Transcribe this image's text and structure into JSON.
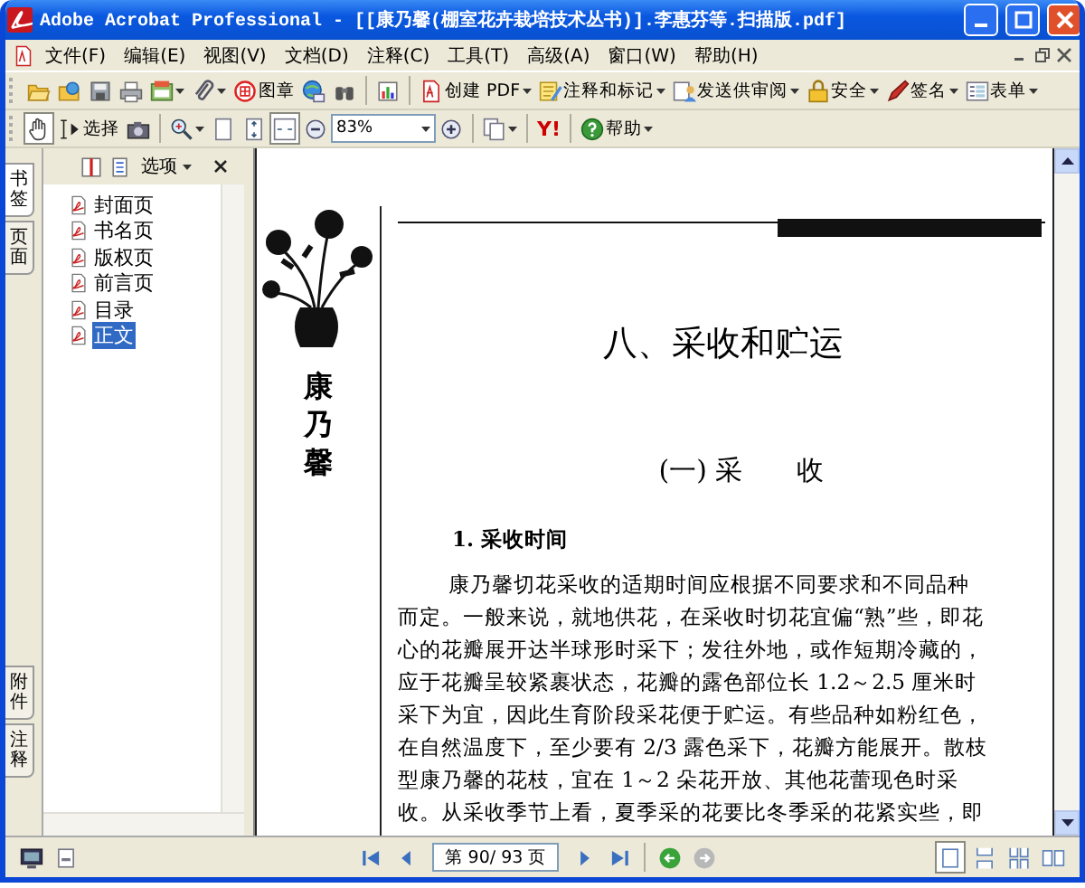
{
  "window": {
    "title": "Adobe Acrobat Professional - [[康乃馨(棚室花卉栽培技术丛书)].李惠芬等.扫描版.pdf]"
  },
  "menu": [
    "文件(F)",
    "编辑(E)",
    "视图(V)",
    "文档(D)",
    "注释(C)",
    "工具(T)",
    "高级(A)",
    "窗口(W)",
    "帮助(H)"
  ],
  "toolbar": [
    {
      "kind": "open"
    },
    {
      "kind": "openweb"
    },
    {
      "kind": "save"
    },
    {
      "kind": "print"
    },
    {
      "kind": "organizer",
      "dropdown": true
    },
    {
      "kind": "attach",
      "dropdown": true
    },
    {
      "kind": "stamp",
      "label": "图章"
    },
    {
      "kind": "email"
    },
    {
      "kind": "find"
    },
    {
      "kind": "separator"
    },
    {
      "kind": "chart"
    },
    {
      "kind": "separator"
    },
    {
      "kind": "createpdf",
      "label": "创建 PDF",
      "dropdown": true
    },
    {
      "kind": "comment",
      "label": "注释和标记",
      "dropdown": true
    },
    {
      "kind": "review",
      "label": "发送供审阅",
      "dropdown": true
    },
    {
      "kind": "lock",
      "label": "安全",
      "dropdown": true
    },
    {
      "kind": "sign",
      "label": "签名",
      "dropdown": true
    },
    {
      "kind": "form",
      "label": "表单",
      "dropdown": true
    }
  ],
  "toolbar2": [
    {
      "kind": "hand",
      "selected": true
    },
    {
      "kind": "select",
      "label": "选择",
      "selected": false
    },
    {
      "kind": "snapshot",
      "selected": false
    },
    {
      "kind": "separator"
    },
    {
      "kind": "zoom",
      "dropdown": true,
      "selected": false
    },
    {
      "kind": "page",
      "selected": false
    },
    {
      "kind": "fitheight",
      "selected": false
    },
    {
      "kind": "fitwidth",
      "selected": true
    },
    {
      "kind": "zoomout",
      "selected": false
    },
    {
      "kind": "zoomfield",
      "value": "83%"
    },
    {
      "kind": "zoomin",
      "selected": false
    },
    {
      "kind": "separator"
    },
    {
      "kind": "pages",
      "dropdown": true,
      "selected": false
    },
    {
      "kind": "separator"
    },
    {
      "kind": "yahoo",
      "label": "Y!",
      "selected": false
    },
    {
      "kind": "separator"
    },
    {
      "kind": "help",
      "label": "帮助",
      "dropdown": true,
      "selected": false
    }
  ],
  "side_tabs_top": [
    {
      "label": "书签",
      "selected": true
    },
    {
      "label": "页面",
      "selected": false
    }
  ],
  "side_tabs_bottom": [
    {
      "label": "附件",
      "selected": false
    },
    {
      "label": "注释",
      "selected": false
    }
  ],
  "nav_panel": {
    "options": "选项",
    "bookmarks": [
      {
        "label": "封面页",
        "selected": false
      },
      {
        "label": "书名页",
        "selected": false
      },
      {
        "label": "版权页",
        "selected": false
      },
      {
        "label": "前言页",
        "selected": false
      },
      {
        "label": "目录",
        "selected": false
      },
      {
        "label": "正文",
        "selected": true
      }
    ]
  },
  "document": {
    "margin_title": "康乃馨",
    "chapter_title": "八、采收和贮运",
    "section_title": "(一) 采　　收",
    "heading": "1. 采收时间",
    "lines": [
      "康乃馨切花采收的适期时间应根据不同要求和不同品种",
      "而定。一般来说，就地供花，在采收时切花宜偏“熟”些，即花",
      "心的花瓣展开达半球形时采下；发往外地，或作短期冷藏的，",
      "应于花瓣呈较紧裹状态，花瓣的露色部位长 1.2～2.5 厘米时",
      "采下为宜，因此生育阶段采花便于贮运。有些品种如粉红色，",
      "在自然温度下，至少要有 2/3 露色采下，花瓣方能展开。散枝",
      "型康乃馨的花枝，宜在 1～2 朵花开放、其他花蕾现色时采",
      "收。从采收季节上看，夏季采的花要比冬季采的花紧实些，即"
    ]
  },
  "status_bar": {
    "left": [
      {
        "kind": "monitor"
      },
      {
        "kind": "tray"
      }
    ],
    "nav": [
      {
        "kind": "first"
      },
      {
        "kind": "prev"
      },
      {
        "kind": "pagefield",
        "value": "第 90/ 93 页"
      },
      {
        "kind": "next"
      },
      {
        "kind": "last"
      },
      {
        "kind": "separator"
      },
      {
        "kind": "back"
      },
      {
        "kind": "forward"
      }
    ],
    "views": [
      {
        "kind": "single",
        "selected": true
      },
      {
        "kind": "continuous",
        "selected": false
      },
      {
        "kind": "facing",
        "selected": false
      },
      {
        "kind": "spread",
        "selected": false
      }
    ]
  }
}
